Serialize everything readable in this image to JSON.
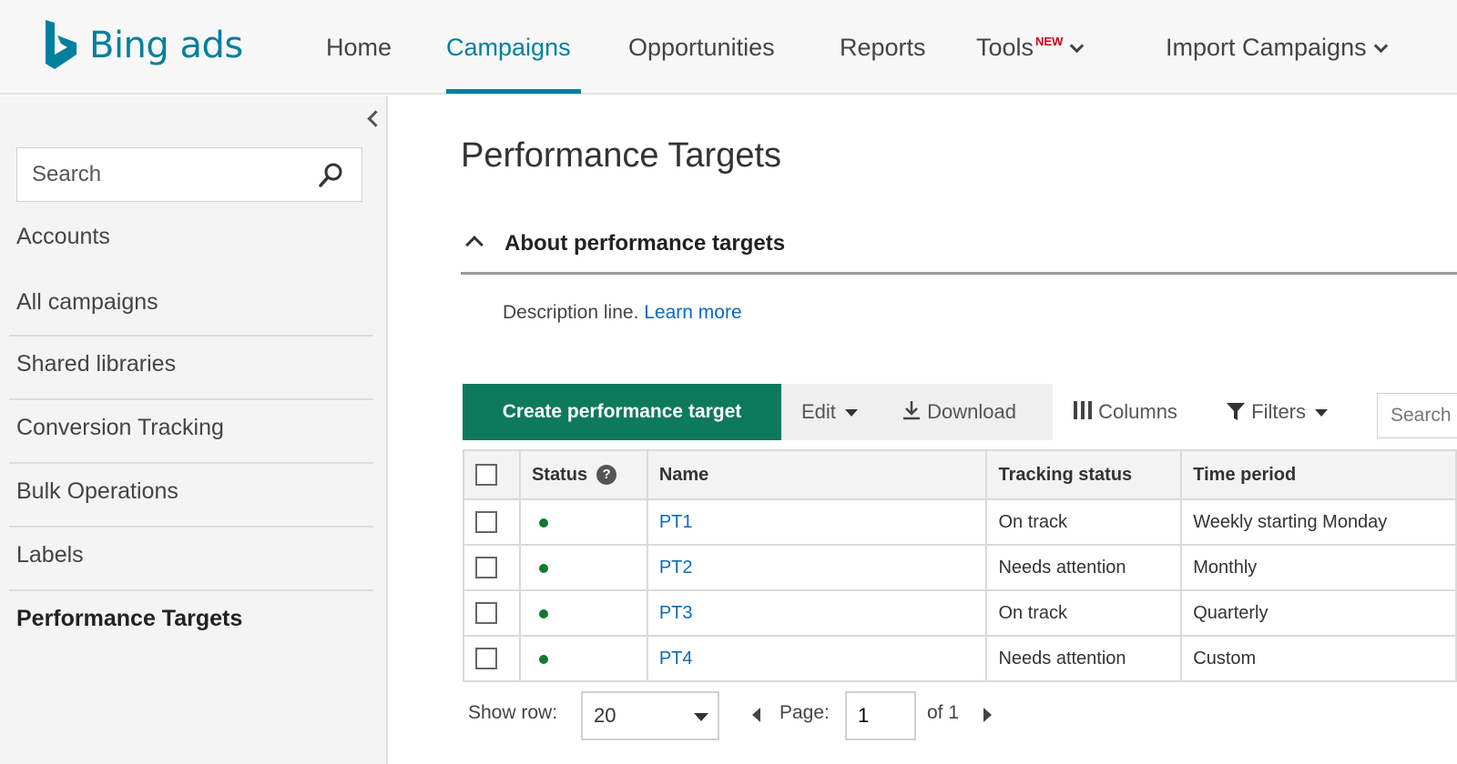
{
  "brand": {
    "name": "Bing ads",
    "color": "#00809d",
    "icon": "bing-logo-icon"
  },
  "nav": {
    "items": [
      {
        "label": "Home"
      },
      {
        "label": "Campaigns",
        "active": true
      },
      {
        "label": "Opportunities"
      },
      {
        "label": "Reports"
      },
      {
        "label": "Tools",
        "badge": "NEW",
        "dropdown": true
      },
      {
        "label": "Import Campaigns",
        "dropdown": true
      }
    ]
  },
  "sidebar": {
    "search_placeholder": "Search",
    "items": [
      {
        "label": "Accounts"
      },
      {
        "label": "All campaigns"
      },
      {
        "label": "Shared libraries"
      },
      {
        "label": "Conversion Tracking"
      },
      {
        "label": "Bulk Operations"
      },
      {
        "label": "Labels"
      },
      {
        "label": "Performance Targets",
        "selected": true
      }
    ]
  },
  "main": {
    "title": "Performance Targets",
    "about": {
      "label": "About performance targets",
      "description": "Description line.",
      "link": "Learn more"
    },
    "toolbar": {
      "create": "Create performance target",
      "edit": "Edit",
      "download": "Download",
      "columns": "Columns",
      "filters": "Filters",
      "search_placeholder": "Search",
      "accent": "#0e7a5c"
    },
    "table": {
      "columns": [
        "Status",
        "Name",
        "Tracking status",
        "Time period"
      ],
      "rows": [
        {
          "name": "PT1",
          "tracking": "On track",
          "tracking_state": "ok",
          "period": "Weekly starting Monday"
        },
        {
          "name": "PT2",
          "tracking": "Needs attention",
          "tracking_state": "warn",
          "period": "Monthly"
        },
        {
          "name": "PT3",
          "tracking": "On track",
          "tracking_state": "ok",
          "period": "Quarterly"
        },
        {
          "name": "PT4",
          "tracking": "Needs attention",
          "tracking_state": "warn",
          "period": "Custom"
        }
      ],
      "status_colors": {
        "ok": "#1a8a2a",
        "warn": "#d6132a"
      }
    },
    "pager": {
      "show_row_label": "Show row:",
      "rows_value": "20",
      "page_label": "Page:",
      "page_value": "1",
      "of_label": "of 1"
    }
  }
}
